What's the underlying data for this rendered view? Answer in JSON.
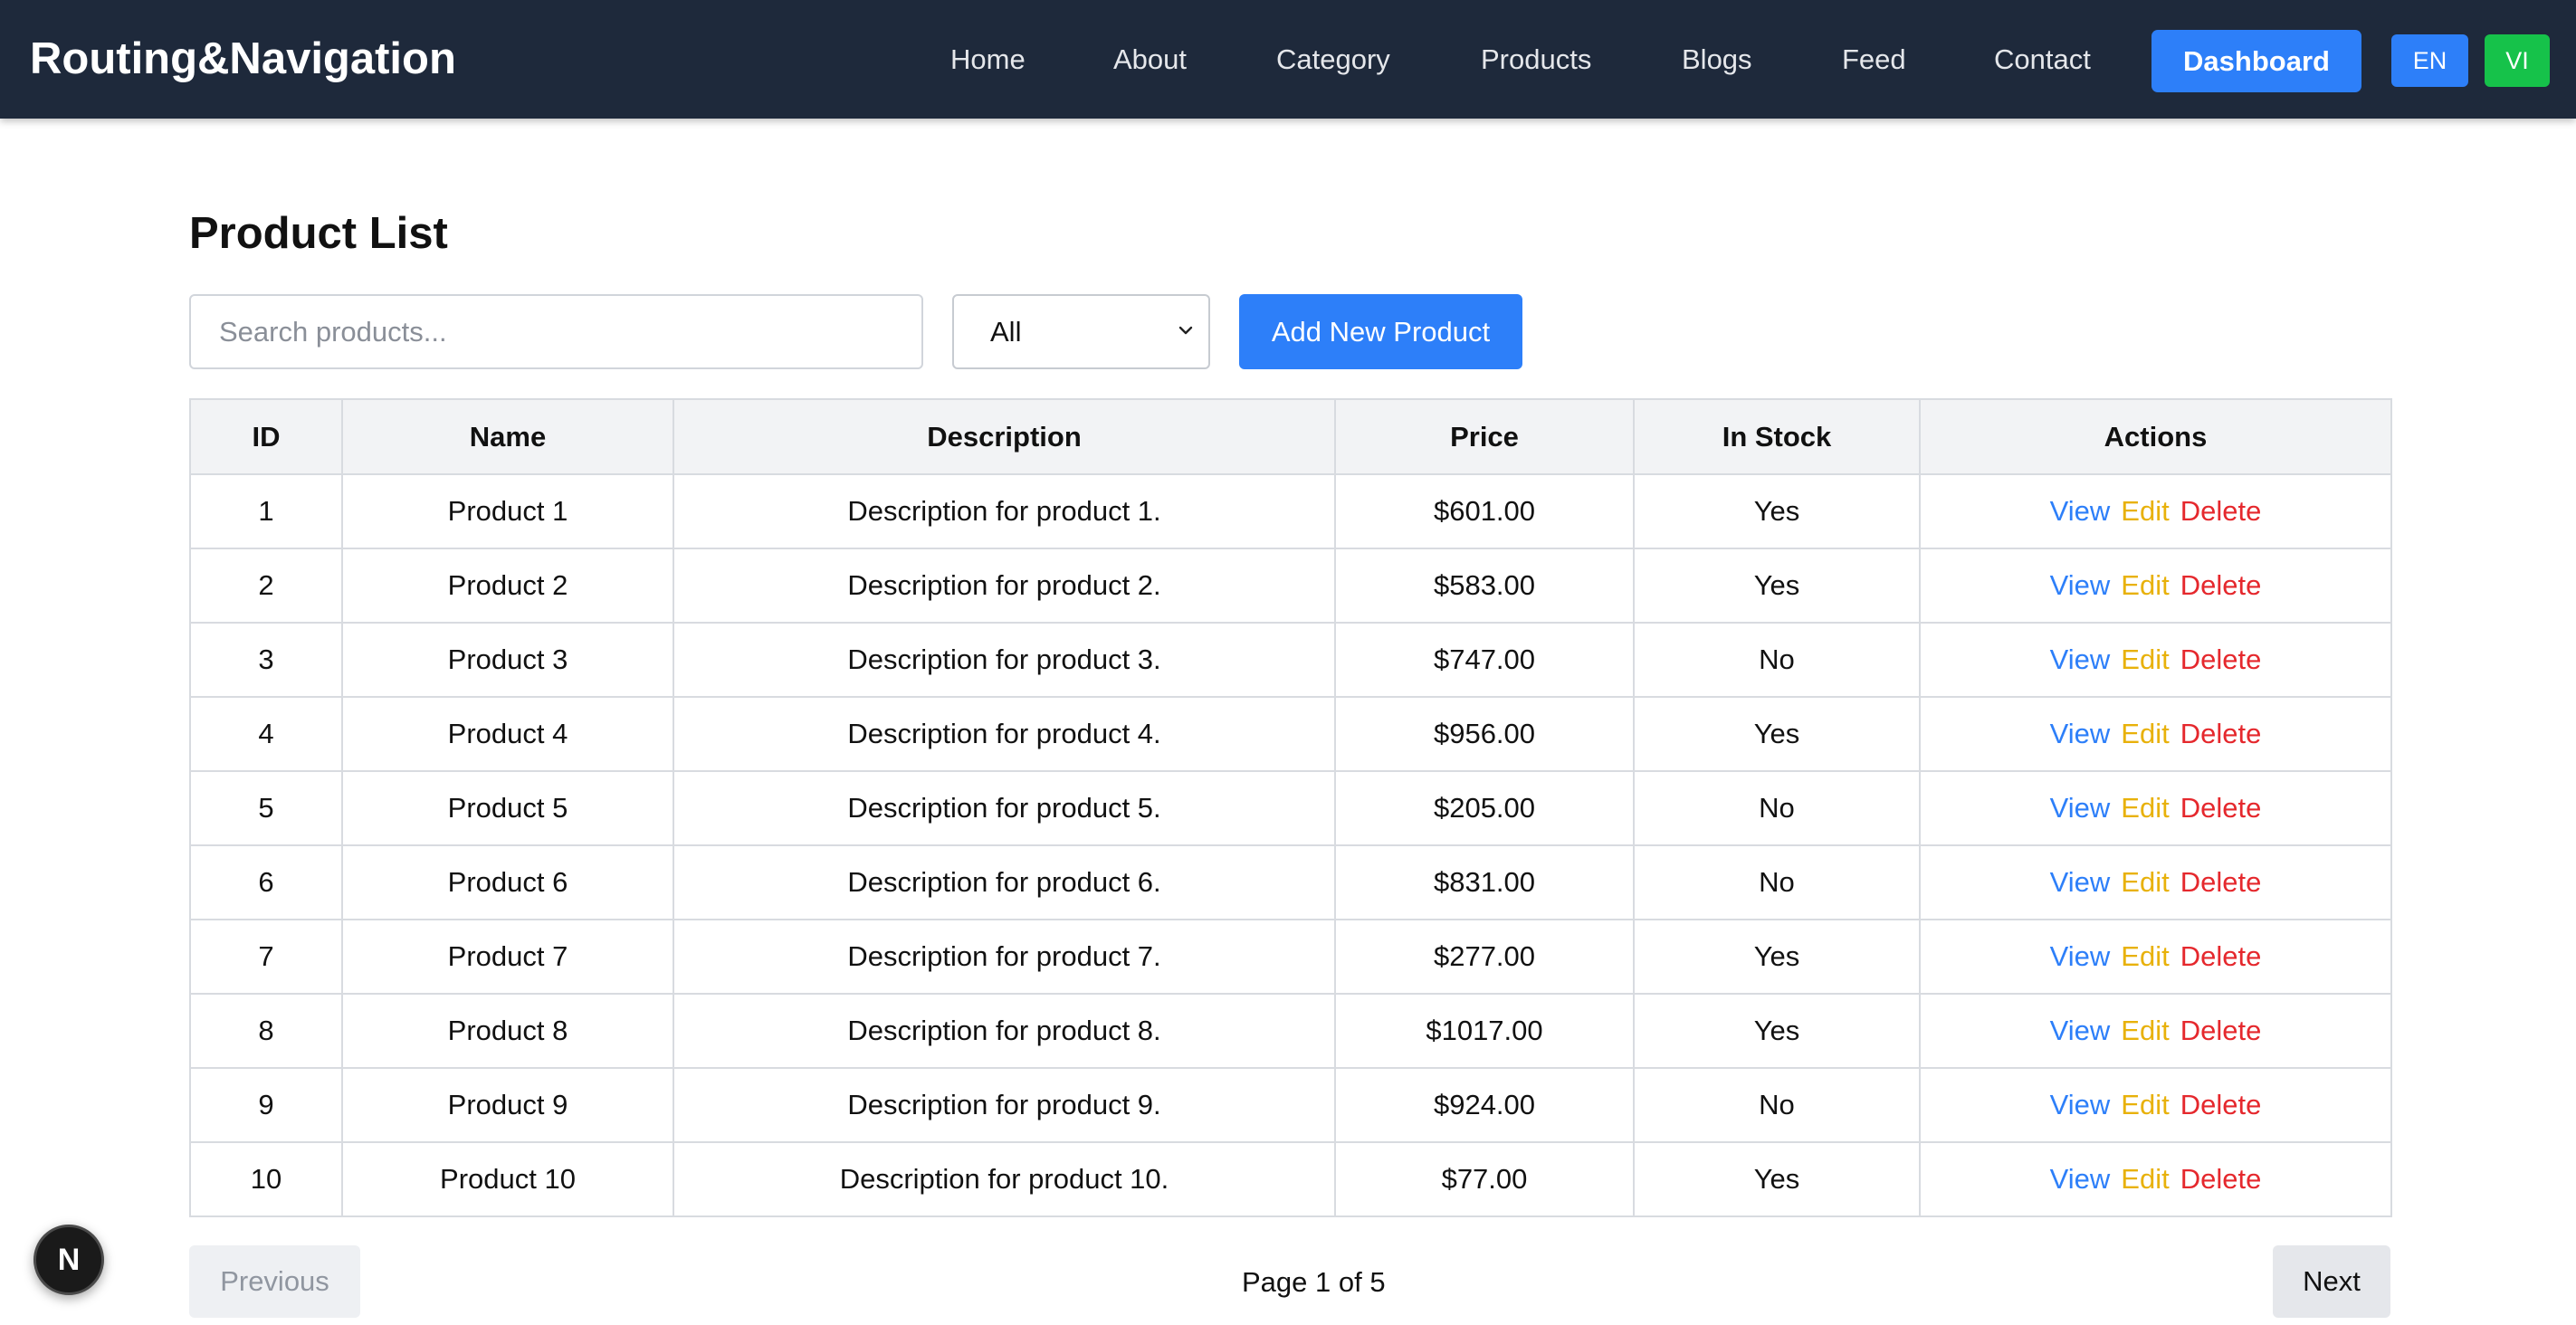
{
  "header": {
    "brand": "Routing&Navigation",
    "nav": [
      "Home",
      "About",
      "Category",
      "Products",
      "Blogs",
      "Feed",
      "Contact"
    ],
    "dashboard_label": "Dashboard",
    "lang_en": "EN",
    "lang_vi": "VI"
  },
  "main": {
    "title": "Product List",
    "search_placeholder": "Search products...",
    "search_value": "",
    "filter_selected": "All",
    "add_label": "Add New Product"
  },
  "table": {
    "headers": [
      "ID",
      "Name",
      "Description",
      "Price",
      "In Stock",
      "Actions"
    ],
    "rows": [
      {
        "id": "1",
        "name": "Product 1",
        "description": "Description for product 1.",
        "price": "$601.00",
        "in_stock": "Yes"
      },
      {
        "id": "2",
        "name": "Product 2",
        "description": "Description for product 2.",
        "price": "$583.00",
        "in_stock": "Yes"
      },
      {
        "id": "3",
        "name": "Product 3",
        "description": "Description for product 3.",
        "price": "$747.00",
        "in_stock": "No"
      },
      {
        "id": "4",
        "name": "Product 4",
        "description": "Description for product 4.",
        "price": "$956.00",
        "in_stock": "Yes"
      },
      {
        "id": "5",
        "name": "Product 5",
        "description": "Description for product 5.",
        "price": "$205.00",
        "in_stock": "No"
      },
      {
        "id": "6",
        "name": "Product 6",
        "description": "Description for product 6.",
        "price": "$831.00",
        "in_stock": "No"
      },
      {
        "id": "7",
        "name": "Product 7",
        "description": "Description for product 7.",
        "price": "$277.00",
        "in_stock": "Yes"
      },
      {
        "id": "8",
        "name": "Product 8",
        "description": "Description for product 8.",
        "price": "$1017.00",
        "in_stock": "Yes"
      },
      {
        "id": "9",
        "name": "Product 9",
        "description": "Description for product 9.",
        "price": "$924.00",
        "in_stock": "No"
      },
      {
        "id": "10",
        "name": "Product 10",
        "description": "Description for product 10.",
        "price": "$77.00",
        "in_stock": "Yes"
      }
    ],
    "actions": {
      "view": "View",
      "edit": "Edit",
      "delete": "Delete"
    }
  },
  "pagination": {
    "previous_label": "Previous",
    "page_text": "Page 1 of 5",
    "next_label": "Next"
  },
  "dev_badge": {
    "letter": "N",
    "icon": "nextjs-logo-icon"
  },
  "colors": {
    "navbar_bg": "#1e293b",
    "primary": "#2d7ff9",
    "success": "#16b34a",
    "danger": "#e5282d",
    "warning": "#e8b10a",
    "lang_vi_bg": "#16c24a"
  }
}
